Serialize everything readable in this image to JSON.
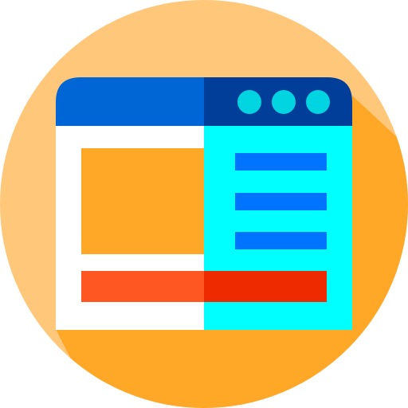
{
  "icon": {
    "name": "browser-window-icon",
    "colors": {
      "circle_light": "#FFC77A",
      "circle_shadow": "#FFA726",
      "titlebar_left": "#0066D6",
      "titlebar_right": "#003E99",
      "window_dots": "#00D4E0",
      "panel_left": "#FFFFFF",
      "panel_right": "#00FFFF",
      "image_block": "#FFA726",
      "text_lines": "#0073FF",
      "bar_left": "#FF5722",
      "bar_right": "#EE2A00"
    }
  }
}
